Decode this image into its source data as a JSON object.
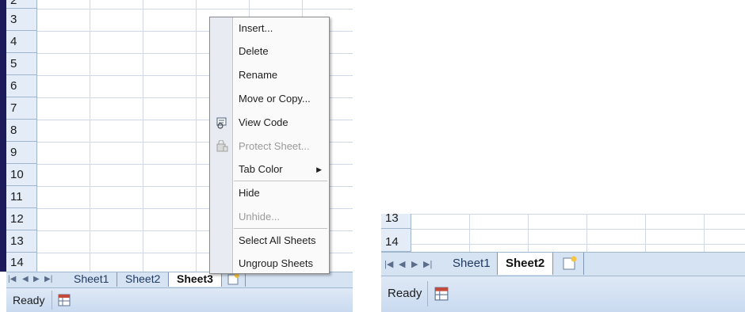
{
  "left_window": {
    "rows": [
      "2",
      "3",
      "4",
      "5",
      "6",
      "7",
      "8",
      "9",
      "10",
      "11",
      "12",
      "13",
      "14"
    ],
    "tabs": [
      "Sheet1",
      "Sheet2",
      "Sheet3"
    ],
    "active_tab": "Sheet3",
    "status": "Ready"
  },
  "context_menu": {
    "items": [
      {
        "label": "Insert...",
        "enabled": true
      },
      {
        "label": "Delete",
        "enabled": true
      },
      {
        "label": "Rename",
        "enabled": true
      },
      {
        "label": "Move or Copy...",
        "enabled": true
      },
      {
        "label": "View Code",
        "enabled": true,
        "icon": "view-code-icon"
      },
      {
        "label": "Protect Sheet...",
        "enabled": false,
        "icon": "protect-sheet-icon"
      },
      {
        "label": "Tab Color",
        "enabled": true,
        "submenu": true
      },
      {
        "label": "Hide",
        "enabled": true
      },
      {
        "label": "Unhide...",
        "enabled": false
      },
      {
        "label": "Select All Sheets",
        "enabled": true
      },
      {
        "label": "Ungroup Sheets",
        "enabled": true
      }
    ]
  },
  "right_window": {
    "rows": [
      "13",
      "14"
    ],
    "tabs": [
      "Sheet1",
      "Sheet2"
    ],
    "active_tab": "Sheet2",
    "status": "Ready"
  },
  "colors": {
    "tab_bar": "#d6e3f3",
    "row_header": "#e4ecf7",
    "grid_line": "#d0d7e5",
    "menu_gutter": "#e8ecf2"
  }
}
